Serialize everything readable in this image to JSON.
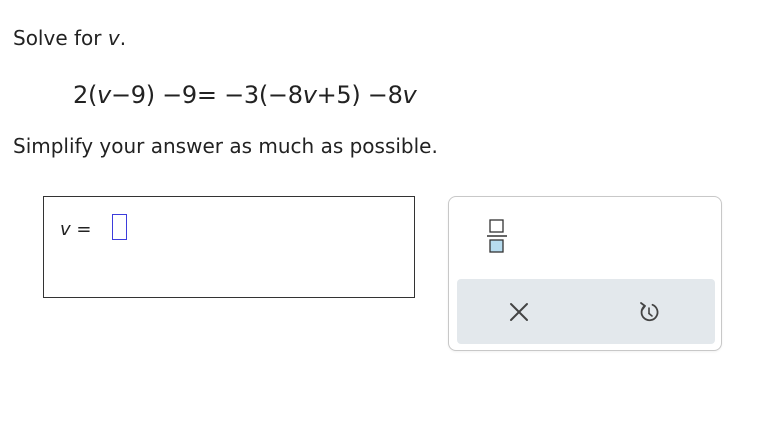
{
  "question": {
    "prompt_prefix": "Solve for ",
    "prompt_variable": "v",
    "prompt_suffix": ".",
    "equation": {
      "lhs": [
        "2(",
        "v",
        "−9) −9"
      ],
      "equals": "=",
      "rhs": [
        "−3(−8",
        "v",
        "+5) −8",
        "v"
      ]
    },
    "instruction": "Simplify your answer as much as possible."
  },
  "answer": {
    "variable": "v",
    "equals": "=",
    "value": "",
    "slot_color": "#3d3ddc"
  },
  "palette": {
    "buttons": [
      {
        "name": "fraction",
        "icon": "fraction-icon"
      }
    ],
    "actions": [
      {
        "name": "clear",
        "icon": "close-icon"
      },
      {
        "name": "undo",
        "icon": "undo-icon"
      }
    ],
    "icon_colors": {
      "box_border": "#333333",
      "box_fill": "#b7dcef",
      "action": "#444444"
    },
    "action_bar_color": "#e3e8ec"
  }
}
